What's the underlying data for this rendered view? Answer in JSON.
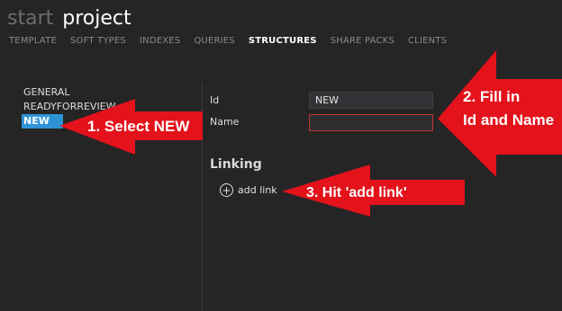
{
  "header": {
    "crumb": "start",
    "title": "project"
  },
  "tabs": [
    {
      "label": "TEMPLATE"
    },
    {
      "label": "SOFT TYPES"
    },
    {
      "label": "INDEXES"
    },
    {
      "label": "QUERIES"
    },
    {
      "label": "STRUCTURES",
      "active": true
    },
    {
      "label": "SHARE PACKS"
    },
    {
      "label": "CLIENTS"
    }
  ],
  "structures": [
    {
      "label": "GENERAL"
    },
    {
      "label": "READYFORREVIEW"
    },
    {
      "label": "NEW",
      "selected": true
    }
  ],
  "form": {
    "id_label": "Id",
    "id_value": "NEW",
    "name_label": "Name",
    "name_value": ""
  },
  "linking": {
    "title": "Linking",
    "add_link": "add link"
  },
  "callouts": {
    "step1": "1. Select NEW",
    "step2_line1": "2. Fill in",
    "step2_line2": "Id and Name",
    "step3": "3. Hit 'add link'"
  },
  "colors": {
    "accent": "#2e94d6",
    "callout_red": "#e3121b",
    "error_border": "#c23535"
  }
}
